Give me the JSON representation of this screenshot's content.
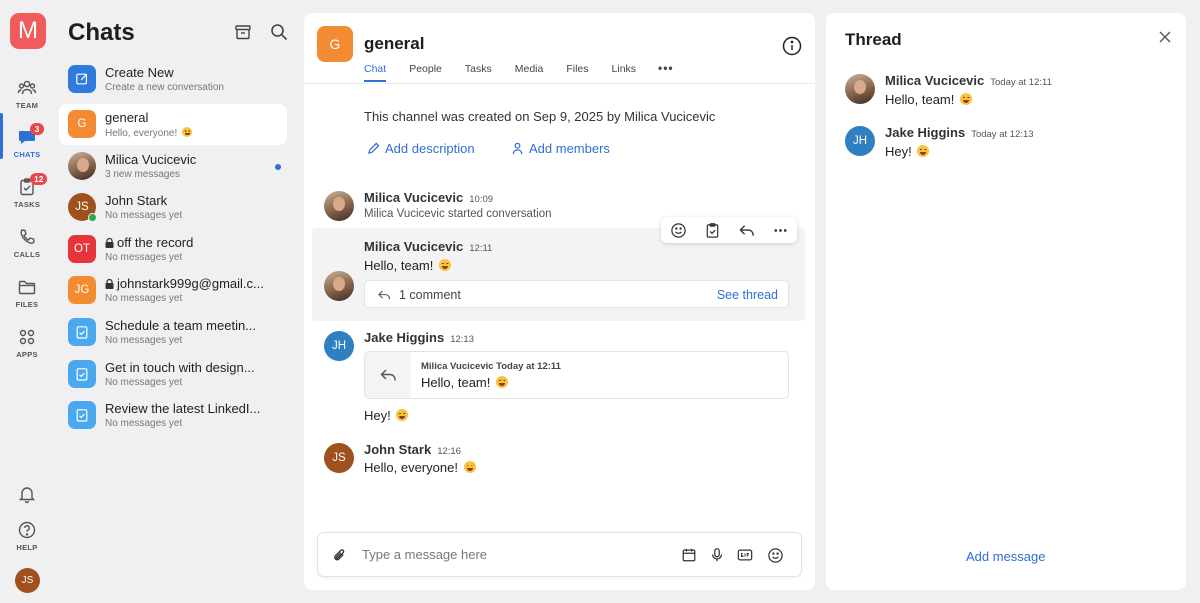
{
  "rail": {
    "logo": "M",
    "items": [
      {
        "label": "TEAM"
      },
      {
        "label": "CHATS",
        "badge": "3"
      },
      {
        "label": "TASKS",
        "badge": "12"
      },
      {
        "label": "CALLS"
      },
      {
        "label": "FILES"
      },
      {
        "label": "APPS"
      }
    ],
    "help_label": "HELP",
    "user_initials": "JS"
  },
  "chats": {
    "title": "Chats",
    "items": [
      {
        "title": "Create New",
        "subtitle": "Create a new conversation",
        "icon": "compose-icon",
        "color": "#2f7bdc"
      },
      {
        "title": "general",
        "subtitle": "Hello, everyone!",
        "avatar": "G",
        "color": "#f38b32"
      },
      {
        "title": "Milica Vucicevic",
        "subtitle": "3 new messages"
      },
      {
        "title": "John Stark",
        "subtitle": "No messages yet",
        "avatar": "JS",
        "color": "#a0501d"
      },
      {
        "title": "off the record",
        "subtitle": "No messages yet",
        "avatar": "OT",
        "color": "#e5343a"
      },
      {
        "title": "johnstark999g@gmail.c...",
        "subtitle": "No messages yet",
        "avatar": "JG",
        "color": "#f38b32"
      },
      {
        "title": "Schedule a team meetin...",
        "subtitle": "No messages yet",
        "icon": "task-icon",
        "color": "#4aa8ef"
      },
      {
        "title": "Get in touch with design...",
        "subtitle": "No messages yet",
        "icon": "task-icon",
        "color": "#4aa8ef"
      },
      {
        "title": "Review the latest LinkedI...",
        "subtitle": "No messages yet",
        "icon": "task-icon",
        "color": "#4aa8ef"
      }
    ]
  },
  "channel": {
    "avatar": "G",
    "name": "general",
    "tabs": [
      "Chat",
      "People",
      "Tasks",
      "Media",
      "Files",
      "Links"
    ],
    "created_text": "This channel was created on Sep 9, 2025  by Milica Vucicevic",
    "add_description": "Add description",
    "add_members": "Add members"
  },
  "messages": [
    {
      "author": "Milica Vucicevic",
      "time": "10:09",
      "text": "Milica Vucicevic started conversation"
    },
    {
      "author": "Milica Vucicevic",
      "time": "12:11",
      "text": "Hello, team!",
      "comments": "1 comment",
      "see_thread": "See thread"
    },
    {
      "author": "Jake Higgins",
      "initials": "JH",
      "time": "12:13",
      "quote_head": "Milica Vucicevic Today at 12:11",
      "quote_text": "Hello, team!",
      "text": "Hey!"
    },
    {
      "author": "John Stark",
      "initials": "JS",
      "time": "12:16",
      "text": "Hello, everyone!"
    }
  ],
  "composer": {
    "placeholder": "Type a message here"
  },
  "thread": {
    "title": "Thread",
    "messages": [
      {
        "author": "Milica Vucicevic",
        "time": "Today at 12:11",
        "text": "Hello, team!"
      },
      {
        "author": "Jake Higgins",
        "initials": "JH",
        "time": "Today at 12:13",
        "text": "Hey!"
      }
    ],
    "add_message": "Add message"
  },
  "colors": {
    "accent": "#2f6fd6",
    "badge": "#e94848",
    "logo": "#f15b5b",
    "jh_avatar": "#2f7fc1",
    "js_avatar": "#a0501d"
  }
}
